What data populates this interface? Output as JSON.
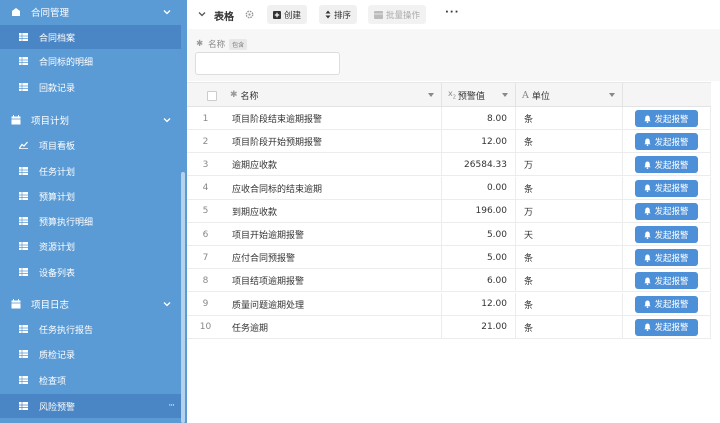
{
  "sidebar": {
    "groups": [
      {
        "label": "合同管理",
        "icon": "contract-group-icon",
        "items": [
          {
            "label": "合同档案",
            "active": true
          },
          {
            "label": "合同标的明细"
          },
          {
            "label": "回款记录"
          }
        ]
      },
      {
        "label": "项目计划",
        "icon": "calendar-icon",
        "items": [
          {
            "label": "项目看板",
            "icon": "chart-line-icon"
          },
          {
            "label": "任务计划"
          },
          {
            "label": "预算计划"
          },
          {
            "label": "预算执行明细"
          },
          {
            "label": "资源计划"
          },
          {
            "label": "设备列表"
          }
        ]
      },
      {
        "label": "项目日志",
        "icon": "calendar-icon",
        "items": [
          {
            "label": "任务执行报告"
          },
          {
            "label": "质检记录"
          },
          {
            "label": "检查项"
          },
          {
            "label": "风险预警",
            "active": true,
            "more": "···"
          }
        ]
      }
    ]
  },
  "toolbar": {
    "title": "表格",
    "create_label": "创建",
    "sort_label": "排序",
    "batch_label": "批量操作",
    "more_label": "···"
  },
  "filter": {
    "label": "名称",
    "tag": "包含",
    "value": ""
  },
  "table": {
    "columns": {
      "name": "名称",
      "value": "预警值",
      "unit": "单位"
    },
    "action_label": "发起报警",
    "rows": [
      {
        "idx": "1",
        "name": "项目阶段结束逾期报警",
        "value": "8.00",
        "unit": "条"
      },
      {
        "idx": "2",
        "name": "项目阶段开始预期报警",
        "value": "12.00",
        "unit": "条"
      },
      {
        "idx": "3",
        "name": "逾期应收款",
        "value": "26584.33",
        "unit": "万"
      },
      {
        "idx": "4",
        "name": "应收合同标的结束逾期",
        "value": "0.00",
        "unit": "条"
      },
      {
        "idx": "5",
        "name": "到期应收款",
        "value": "196.00",
        "unit": "万"
      },
      {
        "idx": "6",
        "name": "项目开始逾期报警",
        "value": "5.00",
        "unit": "天"
      },
      {
        "idx": "7",
        "name": "应付合同预报警",
        "value": "5.00",
        "unit": "条"
      },
      {
        "idx": "8",
        "name": "项目结项逾期报警",
        "value": "6.00",
        "unit": "条"
      },
      {
        "idx": "9",
        "name": "质量问题逾期处理",
        "value": "12.00",
        "unit": "条"
      },
      {
        "idx": "10",
        "name": "任务逾期",
        "value": "21.00",
        "unit": "条"
      }
    ]
  },
  "colors": {
    "sidebar": "#5b9bd5",
    "sidebar_active": "#4a86c5",
    "action_button": "#4d90d8"
  }
}
